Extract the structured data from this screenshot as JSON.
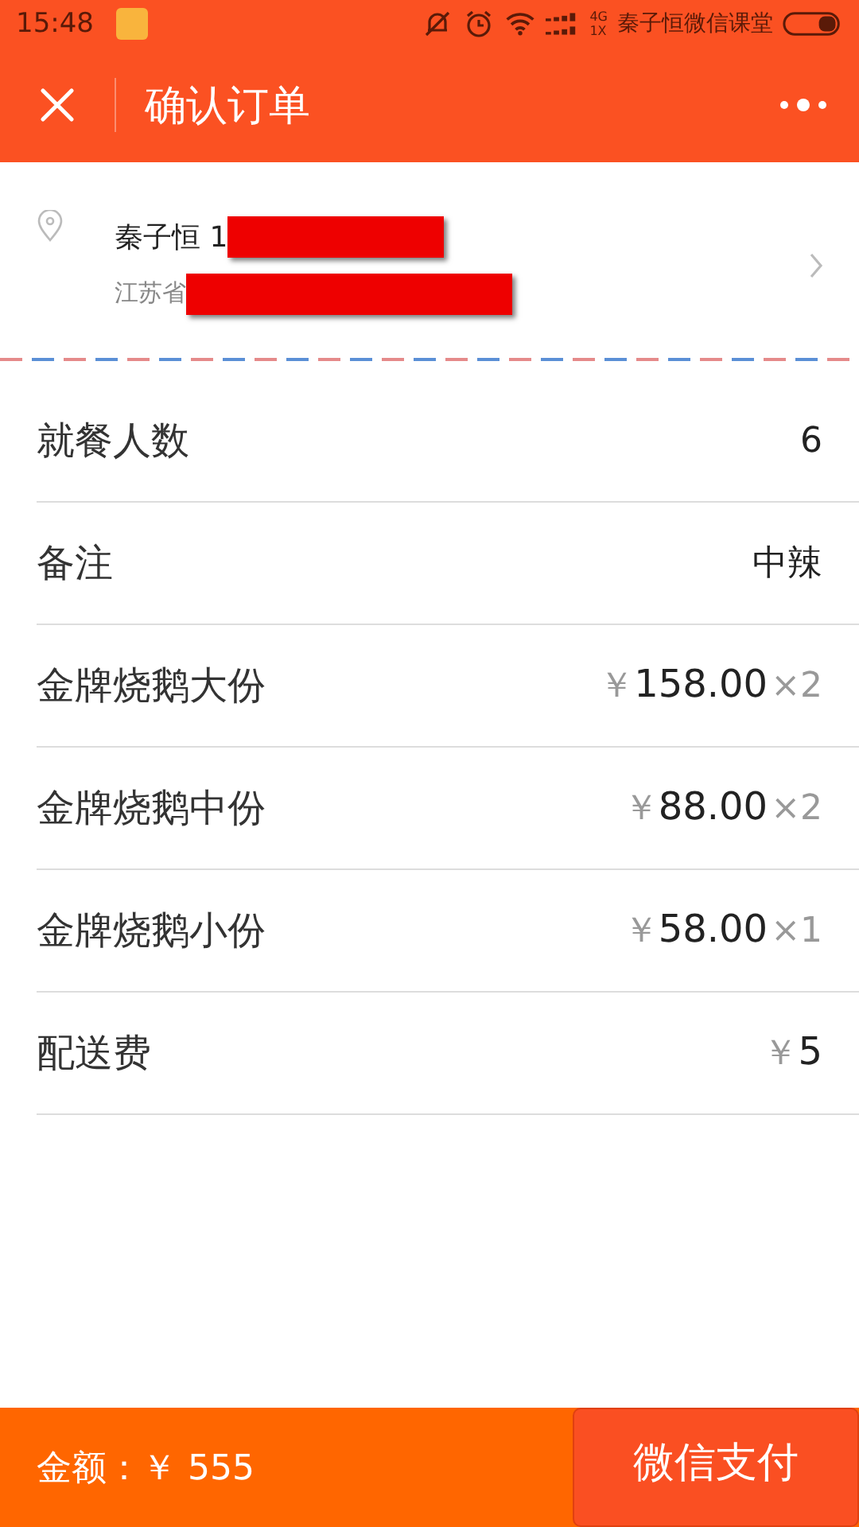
{
  "status_bar": {
    "time": "15:48",
    "network_top": "4G",
    "network_bottom": "1X",
    "carrier": "秦子恒微信课堂"
  },
  "header": {
    "title": "确认订单"
  },
  "address": {
    "name": "秦子恒 1",
    "name_redacted": true,
    "address": "江苏省",
    "address_redacted": true
  },
  "rows": [
    {
      "kind": "text",
      "label": "就餐人数",
      "value": "6"
    },
    {
      "kind": "text",
      "label": "备注",
      "value": "中辣"
    },
    {
      "kind": "item",
      "label": "金牌烧鹅大份",
      "currency": "￥",
      "price": "158.00",
      "quantity": "×2"
    },
    {
      "kind": "item",
      "label": "金牌烧鹅中份",
      "currency": "￥",
      "price": "88.00",
      "quantity": "×2"
    },
    {
      "kind": "item",
      "label": "金牌烧鹅小份",
      "currency": "￥",
      "price": "58.00",
      "quantity": "×1"
    },
    {
      "kind": "fee",
      "label": "配送费",
      "currency": "￥",
      "price": "5"
    }
  ],
  "footer": {
    "total": "金额：￥ 555",
    "pay_button": "微信支付"
  }
}
